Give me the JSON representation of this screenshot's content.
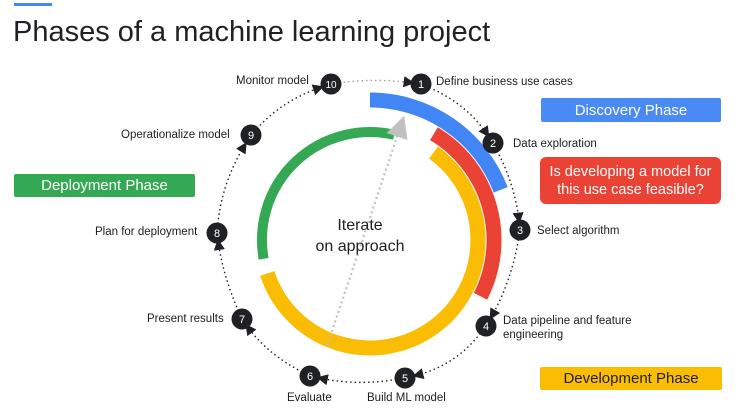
{
  "title": "Phases of a machine learning project",
  "center_text": {
    "line1": "Iterate",
    "line2": "on approach"
  },
  "phases": {
    "discovery": "Discovery Phase",
    "feasibility_question": "Is developing a model for this use case feasible?",
    "deployment": "Deployment Phase",
    "development": "Development Phase"
  },
  "colors": {
    "discovery": "#4285f4",
    "feasibility": "#ea4335",
    "development": "#fbbc04",
    "deployment": "#34a853",
    "step_circle": "#202124"
  },
  "steps": [
    {
      "num": "1",
      "label": "Define business use cases"
    },
    {
      "num": "2",
      "label": "Data exploration"
    },
    {
      "num": "3",
      "label": "Select algorithm"
    },
    {
      "num": "4",
      "label": "Data pipeline and feature",
      "label2": "engineering"
    },
    {
      "num": "5",
      "label": "Build ML model"
    },
    {
      "num": "6",
      "label": "Evaluate"
    },
    {
      "num": "7",
      "label": "Present results"
    },
    {
      "num": "8",
      "label": "Plan for deployment"
    },
    {
      "num": "9",
      "label": "Operationalize model"
    },
    {
      "num": "10",
      "label": "Monitor model"
    }
  ]
}
